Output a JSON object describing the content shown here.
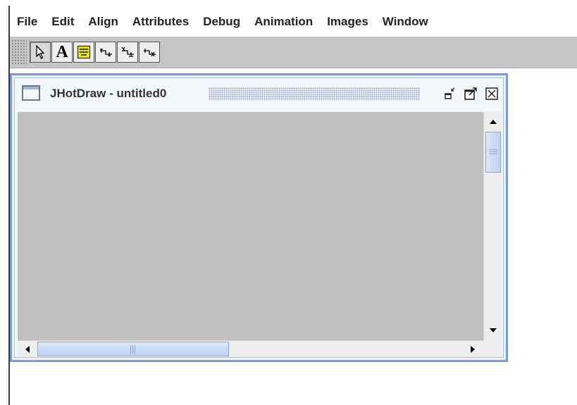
{
  "menu": {
    "items": [
      "File",
      "Edit",
      "Align",
      "Attributes",
      "Debug",
      "Animation",
      "Images",
      "Window"
    ]
  },
  "toolbar": {
    "tools": [
      {
        "icon": "selection-arrow-icon",
        "selected": true
      },
      {
        "icon": "text-tool-icon",
        "label": "A"
      },
      {
        "icon": "text-area-tool-icon"
      },
      {
        "icon": "connection-tool-icon"
      },
      {
        "icon": "elbow-connection-tool-icon"
      },
      {
        "icon": "line-connection-tool-icon"
      }
    ]
  },
  "window": {
    "title": "JHotDraw - untitled0",
    "icons": {
      "frame": "frame-window-icon",
      "minimize": "minimize-icon",
      "maximize": "maximize-icon",
      "close": "close-icon"
    }
  },
  "colors": {
    "canvas": "#c0c0c0",
    "toolbar": "#c6c6c6",
    "frame_border": "#7b9bd2",
    "scroll_thumb": "#bed2f2",
    "text_tool_fill": "#e8e800"
  }
}
